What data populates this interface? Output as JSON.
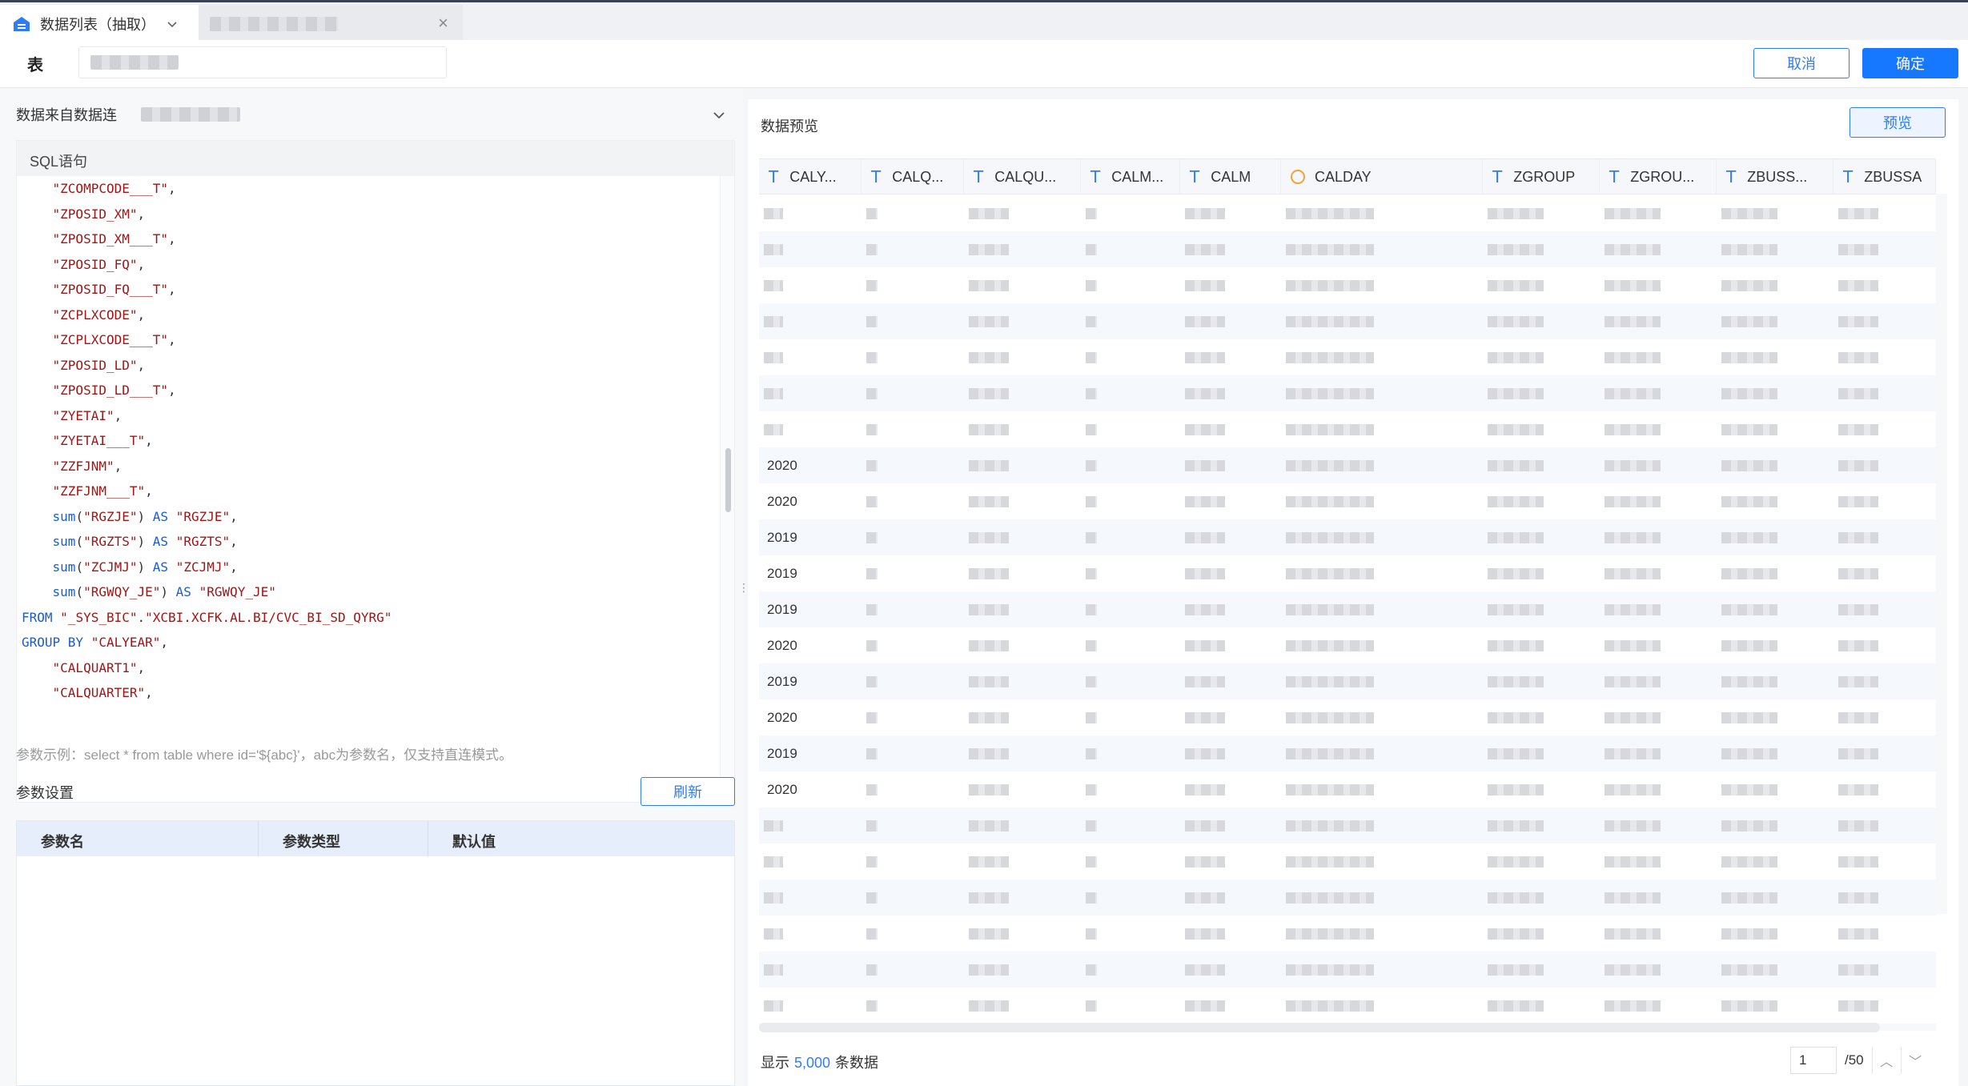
{
  "tabs": [
    {
      "label": "数据列表（抽取）"
    }
  ],
  "table_label": "表",
  "buttons": {
    "cancel": "取消",
    "confirm": "确定",
    "refresh": "刷新",
    "preview": "预览"
  },
  "source": {
    "label": "数据来自数据连"
  },
  "sql": {
    "heading": "SQL语句",
    "lines": [
      [
        {
          "t": "    "
        },
        {
          "c": "str",
          "t": "\"ZCOMPCODE___T\""
        },
        {
          "t": ","
        }
      ],
      [
        {
          "t": "    "
        },
        {
          "c": "str",
          "t": "\"ZPOSID_XM\""
        },
        {
          "t": ","
        }
      ],
      [
        {
          "t": "    "
        },
        {
          "c": "str",
          "t": "\"ZPOSID_XM___T\""
        },
        {
          "t": ","
        }
      ],
      [
        {
          "t": "    "
        },
        {
          "c": "str",
          "t": "\"ZPOSID_FQ\""
        },
        {
          "t": ","
        }
      ],
      [
        {
          "t": "    "
        },
        {
          "c": "str",
          "t": "\"ZPOSID_FQ___T\""
        },
        {
          "t": ","
        }
      ],
      [
        {
          "t": "    "
        },
        {
          "c": "str",
          "t": "\"ZCPLXCODE\""
        },
        {
          "t": ","
        }
      ],
      [
        {
          "t": "    "
        },
        {
          "c": "str",
          "t": "\"ZCPLXCODE___T\""
        },
        {
          "t": ","
        }
      ],
      [
        {
          "t": "    "
        },
        {
          "c": "str",
          "t": "\"ZPOSID_LD\""
        },
        {
          "t": ","
        }
      ],
      [
        {
          "t": "    "
        },
        {
          "c": "str",
          "t": "\"ZPOSID_LD___T\""
        },
        {
          "t": ","
        }
      ],
      [
        {
          "t": "    "
        },
        {
          "c": "str",
          "t": "\"ZYETAI\""
        },
        {
          "t": ","
        }
      ],
      [
        {
          "t": "    "
        },
        {
          "c": "str",
          "t": "\"ZYETAI___T\""
        },
        {
          "t": ","
        }
      ],
      [
        {
          "t": "    "
        },
        {
          "c": "str",
          "t": "\"ZZFJNM\""
        },
        {
          "t": ","
        }
      ],
      [
        {
          "t": "    "
        },
        {
          "c": "str",
          "t": "\"ZZFJNM___T\""
        },
        {
          "t": ","
        }
      ],
      [
        {
          "t": "    "
        },
        {
          "c": "fn",
          "t": "sum"
        },
        {
          "t": "("
        },
        {
          "c": "str",
          "t": "\"RGZJE\""
        },
        {
          "t": ") "
        },
        {
          "c": "kw",
          "t": "AS"
        },
        {
          "t": " "
        },
        {
          "c": "str",
          "t": "\"RGZJE\""
        },
        {
          "t": ","
        }
      ],
      [
        {
          "t": "    "
        },
        {
          "c": "fn",
          "t": "sum"
        },
        {
          "t": "("
        },
        {
          "c": "str",
          "t": "\"RGZTS\""
        },
        {
          "t": ") "
        },
        {
          "c": "kw",
          "t": "AS"
        },
        {
          "t": " "
        },
        {
          "c": "str",
          "t": "\"RGZTS\""
        },
        {
          "t": ","
        }
      ],
      [
        {
          "t": "    "
        },
        {
          "c": "fn",
          "t": "sum"
        },
        {
          "t": "("
        },
        {
          "c": "str",
          "t": "\"ZCJMJ\""
        },
        {
          "t": ") "
        },
        {
          "c": "kw",
          "t": "AS"
        },
        {
          "t": " "
        },
        {
          "c": "str",
          "t": "\"ZCJMJ\""
        },
        {
          "t": ","
        }
      ],
      [
        {
          "t": "    "
        },
        {
          "c": "fn",
          "t": "sum"
        },
        {
          "t": "("
        },
        {
          "c": "str",
          "t": "\"RGWQY_JE\""
        },
        {
          "t": ") "
        },
        {
          "c": "kw",
          "t": "AS"
        },
        {
          "t": " "
        },
        {
          "c": "str",
          "t": "\"RGWQY_JE\""
        }
      ],
      [
        {
          "c": "kw",
          "t": "FROM"
        },
        {
          "t": " "
        },
        {
          "c": "str",
          "t": "\"_SYS_BIC\""
        },
        {
          "t": "."
        },
        {
          "c": "str",
          "t": "\"XCBI.XCFK.AL.BI/CVC_BI_SD_QYRG\""
        }
      ],
      [
        {
          "c": "kw",
          "t": "GROUP BY"
        },
        {
          "t": " "
        },
        {
          "c": "str",
          "t": "\"CALYEAR\""
        },
        {
          "t": ","
        }
      ],
      [
        {
          "t": "    "
        },
        {
          "c": "str",
          "t": "\"CALQUART1\""
        },
        {
          "t": ","
        }
      ],
      [
        {
          "t": "    "
        },
        {
          "c": "str",
          "t": "\"CALQUARTER\""
        },
        {
          "t": ","
        }
      ]
    ]
  },
  "param_hint": "参数示例：select * from table where id='${abc}'，abc为参数名，仅支持直连模式。",
  "param_section_title": "参数设置",
  "param_columns": [
    "参数名",
    "参数类型",
    "默认值"
  ],
  "preview": {
    "title": "数据预览",
    "columns": [
      {
        "name": "CALY...",
        "type": "text",
        "width": 128
      },
      {
        "name": "CALQ...",
        "type": "text",
        "width": 128
      },
      {
        "name": "CALQU...",
        "type": "text",
        "width": 146
      },
      {
        "name": "CALM...",
        "type": "text",
        "width": 124
      },
      {
        "name": "CALM",
        "type": "text",
        "width": 126
      },
      {
        "name": "CALDAY",
        "type": "date",
        "width": 252
      },
      {
        "name": "ZGROUP",
        "type": "text",
        "width": 146
      },
      {
        "name": "ZGROU...",
        "type": "text",
        "width": 146
      },
      {
        "name": "ZBUSS...",
        "type": "text",
        "width": 146
      },
      {
        "name": "ZBUSSA",
        "type": "text",
        "width": 128
      }
    ],
    "rows_year": [
      "",
      "",
      "",
      "",
      "",
      "",
      "",
      "2020",
      "2020",
      "2019",
      "2019",
      "2019",
      "2020",
      "2019",
      "2020",
      "2019",
      "2020",
      "",
      "",
      "",
      "",
      "",
      "",
      ""
    ]
  },
  "footer": {
    "prefix": "显示",
    "count": "5,000",
    "suffix": "条数据",
    "page_value": "1",
    "page_total": "/50"
  }
}
